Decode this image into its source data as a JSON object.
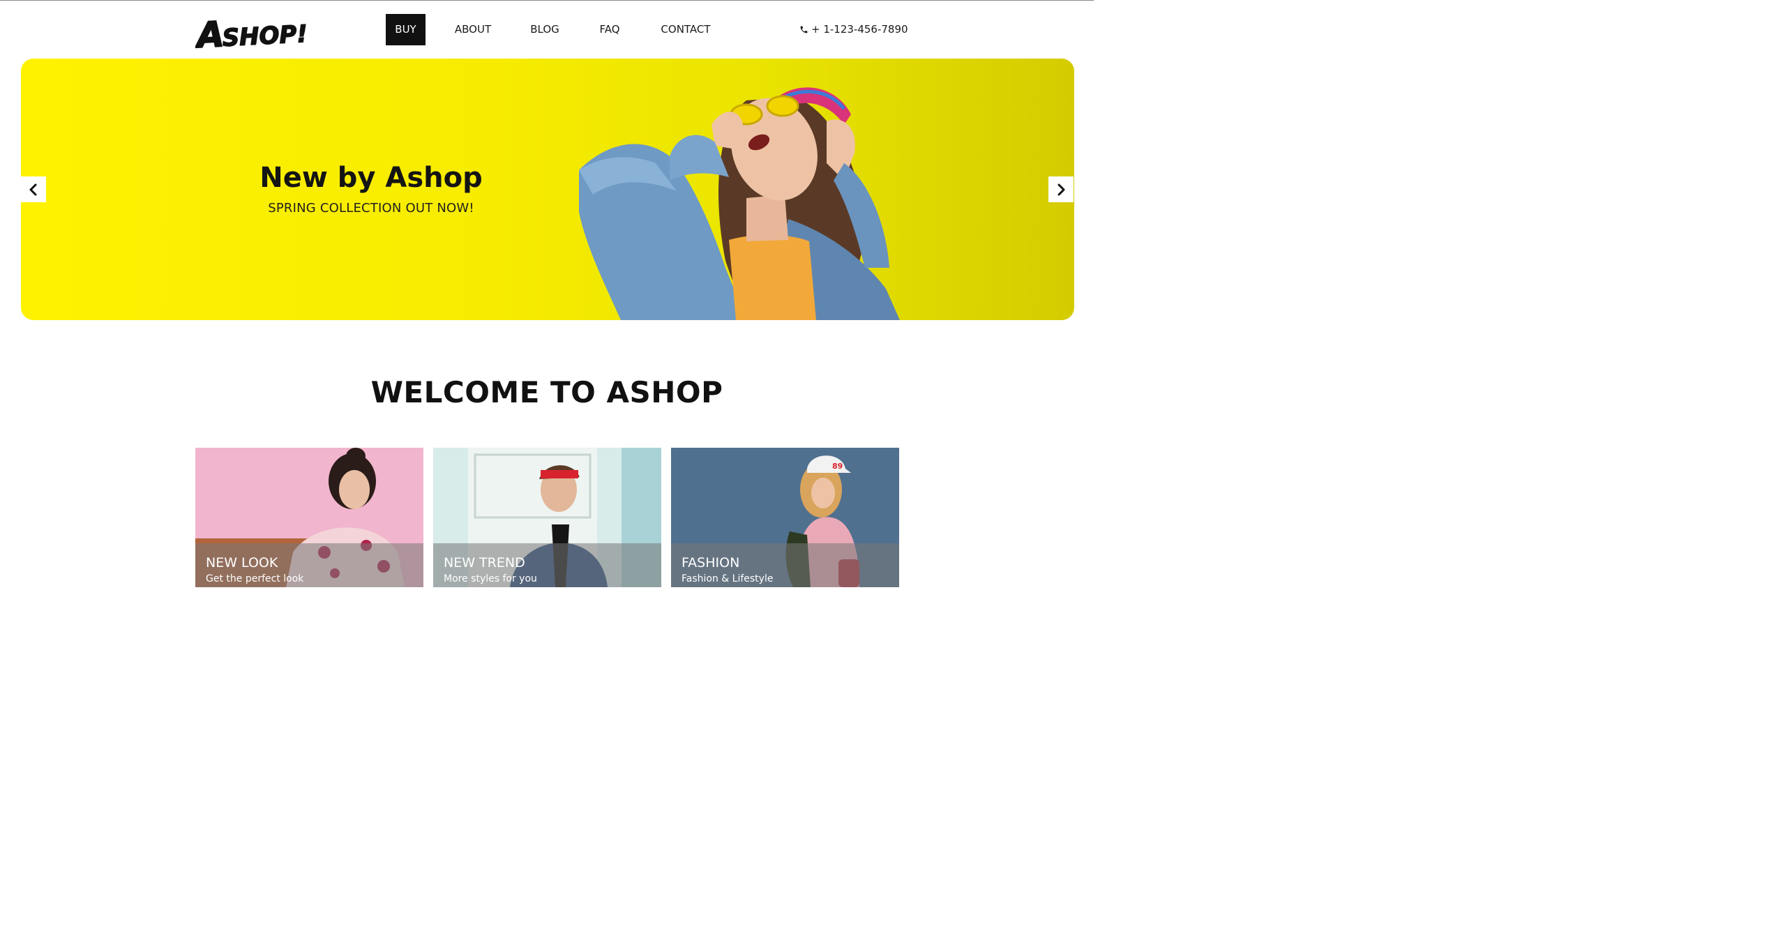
{
  "header": {
    "logo_text": "Ashop!",
    "nav": [
      {
        "label": "BUY",
        "active": true
      },
      {
        "label": "ABOUT",
        "active": false
      },
      {
        "label": "BLOG",
        "active": false
      },
      {
        "label": "FAQ",
        "active": false
      },
      {
        "label": "CONTACT",
        "active": false
      }
    ],
    "phone": "+ 1-123-456-7890",
    "phone_icon": "phone-icon"
  },
  "hero": {
    "title": "New by Ashop",
    "subtitle": "SPRING COLLECTION OUT NOW!",
    "background_color": "#f6ee00",
    "prev_icon": "chevron-left-icon",
    "next_icon": "chevron-right-icon"
  },
  "welcome": {
    "heading": "WELCOME TO ASHOP"
  },
  "categories": [
    {
      "title": "NEW LOOK",
      "subtitle": "Get the perfect look",
      "background": "#f2b3cc"
    },
    {
      "title": "NEW TREND",
      "subtitle": "More styles for you",
      "background": "#cfe5e2"
    },
    {
      "title": "FASHION",
      "subtitle": "Fashion & Lifestyle",
      "background": "#4f6f8f"
    }
  ]
}
